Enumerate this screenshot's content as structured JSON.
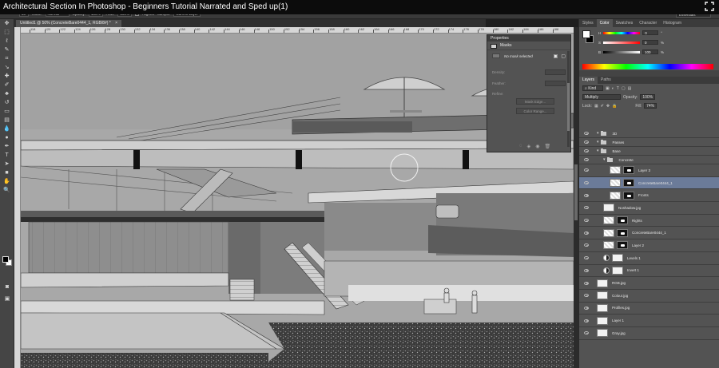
{
  "video": {
    "title": "Architectural Section In Photoshop - Beginners Tutorial Narrated and Sped up(1)"
  },
  "options_bar": {
    "brush_size": "30",
    "mode_label": "Mode:",
    "mode_value": "Normal",
    "opacity_label": "Opacity:",
    "opacity_value": "100%",
    "flow_label": "Flow:",
    "flow_value": "100%",
    "aligned_label": "Aligned",
    "sample_label": "Sample:",
    "sample_value": "Current Layer",
    "workspace": "Essentials"
  },
  "document": {
    "tab_label": "Untitled1 @ 50% (ConcreteBare0444_1, RGB/8#) *"
  },
  "ruler_ticks": [
    "118",
    "120",
    "122",
    "124",
    "126",
    "128",
    "130",
    "132",
    "134",
    "136",
    "138",
    "140",
    "142",
    "144",
    "146",
    "148",
    "150",
    "152",
    "154",
    "156",
    "158",
    "160",
    "162",
    "164",
    "166",
    "168",
    "170",
    "172",
    "174",
    "176",
    "178",
    "180",
    "182",
    "184",
    "186",
    "188"
  ],
  "properties": {
    "title": "Properties",
    "tab": "Masks",
    "no_mask": "No mask selected",
    "density_label": "Density:",
    "feather_label": "Feather:",
    "refine_label": "Refine:",
    "mask_edge_btn": "Mask Edge...",
    "color_range_btn": "Color Range..."
  },
  "color_panel": {
    "tabs": [
      "Styles",
      "Color",
      "Swatches",
      "Character",
      "Histogram"
    ],
    "active_tab": "Color",
    "h_label": "H",
    "h_value": "0",
    "s_label": "S",
    "s_value": "0",
    "b_label": "B",
    "b_value": "100",
    "unit_deg": "°",
    "unit_pct": "%"
  },
  "layers_panel": {
    "tabs": [
      "Layers",
      "Paths"
    ],
    "active_tab": "Layers",
    "kind_label": "Kind",
    "blend_mode": "Multiply",
    "opacity_label": "Opacity:",
    "opacity_value": "100%",
    "lock_label": "Lock:",
    "fill_label": "Fill:",
    "fill_value": "74%",
    "layers": [
      {
        "name": "3D",
        "type": "group",
        "indent": 0
      },
      {
        "name": "Passes",
        "type": "group",
        "indent": 0
      },
      {
        "name": "Base",
        "type": "group",
        "indent": 0
      },
      {
        "name": "Concrete",
        "type": "group",
        "indent": 1
      },
      {
        "name": "Layer 3",
        "type": "layer-mask",
        "indent": 2
      },
      {
        "name": "ConcreteBare0444_1",
        "type": "layer-mask",
        "indent": 2,
        "selected": true
      },
      {
        "name": "Fronts",
        "type": "layer-mask",
        "indent": 2
      },
      {
        "name": "Noshadow.jpg",
        "type": "layer",
        "indent": 1
      },
      {
        "name": "Rights",
        "type": "layer-mask",
        "indent": 1
      },
      {
        "name": "ConcreteBare0444_1",
        "type": "layer-mask",
        "indent": 1
      },
      {
        "name": "Layer 2",
        "type": "layer-mask",
        "indent": 1
      },
      {
        "name": "Levels 1",
        "type": "adjustment",
        "indent": 1
      },
      {
        "name": "Invert 1",
        "type": "adjustment",
        "indent": 1
      },
      {
        "name": "RGB.jpg",
        "type": "layer",
        "indent": 0
      },
      {
        "name": "Colour.jpg",
        "type": "layer",
        "indent": 0
      },
      {
        "name": "Profiles.jpg",
        "type": "layer",
        "indent": 0
      },
      {
        "name": "Layer 1",
        "type": "layer",
        "indent": 0
      },
      {
        "name": "Gray.jpg",
        "type": "layer",
        "indent": 0
      }
    ]
  }
}
